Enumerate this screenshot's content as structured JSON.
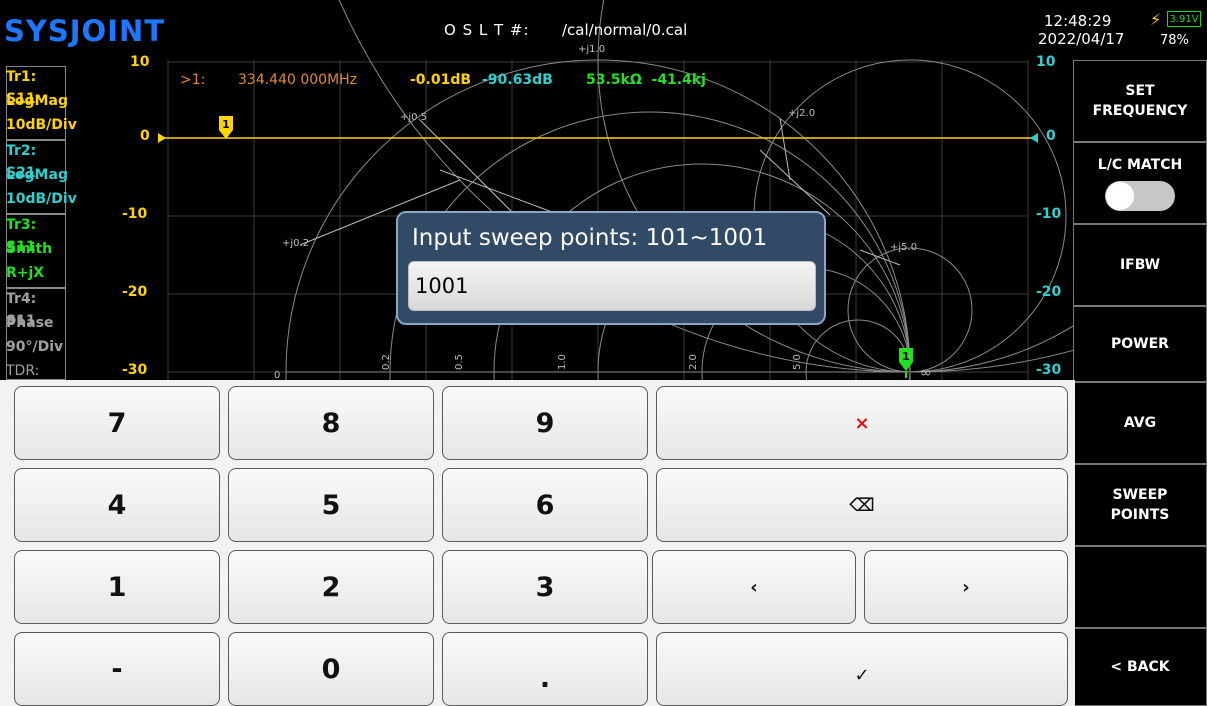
{
  "header": {
    "logo": "SYSJOINT",
    "oslt_label": "O S L T #:",
    "cal_path": "/cal/normal/0.cal",
    "time": "12:48:29",
    "date": "2022/04/17",
    "battery_voltage": "3.91V",
    "battery_percent": "78%"
  },
  "traces": [
    {
      "line1": "Tr1:  S11",
      "line2": "LogMag",
      "line3": "10dB/Div",
      "color": "#ffd400"
    },
    {
      "line1": "Tr2:  S21",
      "line2": "LogMag",
      "line3": "10dB/Div",
      "color": "#2fd0d0"
    },
    {
      "line1": "Tr3:  S11",
      "line2": "Smith",
      "line3": "R+jX",
      "color": "#22e022"
    },
    {
      "line1": "Tr4:  S11",
      "line2": "Phase",
      "line3": "90°/Div",
      "color": "#a0a0a0"
    },
    {
      "line1": "TDR:",
      "color": "#a0a0a0"
    }
  ],
  "left_axis": [
    "10",
    "0",
    "-10",
    "-20",
    "-30"
  ],
  "right_axis": [
    "10",
    "0",
    "-10",
    "-20",
    "-30"
  ],
  "smith_labels": {
    "top": "+j1.0",
    "j05": "+j0.5",
    "j20": "+j2.0",
    "j02": "+j0.2",
    "j50": "+j5.0",
    "r0": "0",
    "r02": "0.2",
    "r05": "0.5",
    "r10": "1.0",
    "r20": "2.0",
    "r50": "5.0",
    "inf": "∞"
  },
  "marker": {
    "id": ">1:",
    "frequency": "334.440 000MHz",
    "tr1_value": "-0.01dB",
    "tr2_value": "-90.63dB",
    "tr3_value": "53.5kΩ  -41.4kj",
    "label_tr1": "1",
    "label_tr3": "1"
  },
  "menu": {
    "set_frequency_l1": "SET",
    "set_frequency_l2": "FREQUENCY",
    "lc_match": "L/C MATCH",
    "lc_match_on": false,
    "ifbw": "IFBW",
    "power": "POWER",
    "avg": "AVG",
    "sweep_points_l1": "SWEEP",
    "sweep_points_l2": "POINTS",
    "back": "< BACK"
  },
  "dialog": {
    "title": "Input sweep points: 101~1001",
    "value": "1001"
  },
  "keypad": {
    "k7": "7",
    "k8": "8",
    "k9": "9",
    "clear": "×",
    "k4": "4",
    "k5": "5",
    "k6": "6",
    "backspace": "⌫",
    "k1": "1",
    "k2": "2",
    "k3": "3",
    "left": "‹",
    "right": "›",
    "minus": "-",
    "k0": "0",
    "dot": ".",
    "ok": "✓"
  },
  "colors": {
    "tr1": "#ffd400",
    "tr2": "#2fd0d0",
    "tr3": "#22e022",
    "marker_freq": "#e08a2a",
    "dialog_bg": "#314a66"
  }
}
